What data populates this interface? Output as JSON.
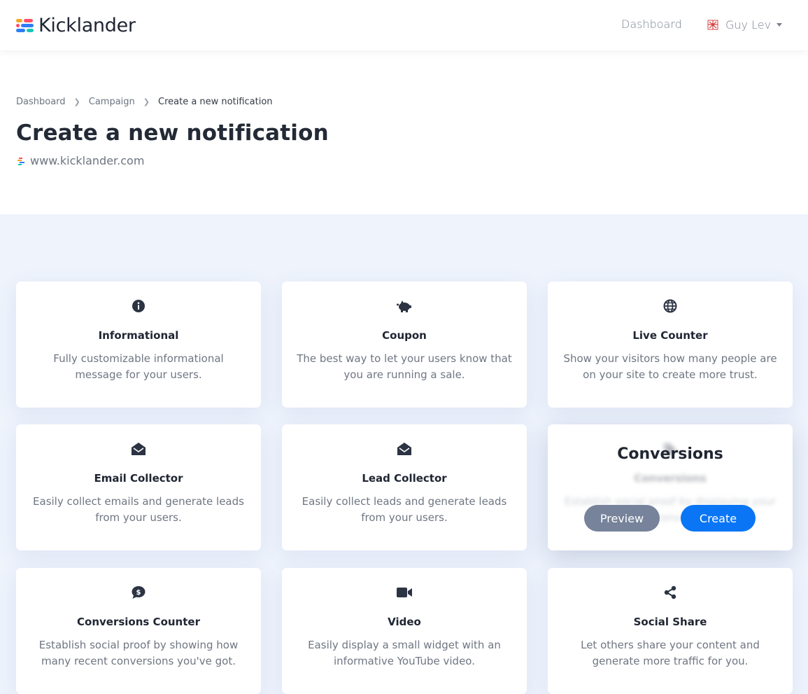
{
  "navbar": {
    "brand": "Kicklander",
    "dashboard_link": "Dashboard",
    "user_name": "Guy Lev"
  },
  "breadcrumb": [
    "Dashboard",
    "Campaign",
    "Create a new notification"
  ],
  "page": {
    "title": "Create a new notification",
    "site_url": "www.kicklander.com"
  },
  "cards": [
    {
      "title": "Informational",
      "desc": "Fully customizable informational message for your users.",
      "icon": "info-circle-icon"
    },
    {
      "title": "Coupon",
      "desc": "The best way to let your users know that you are running a sale.",
      "icon": "piggy-bank-icon"
    },
    {
      "title": "Live Counter",
      "desc": "Show your visitors how many people are on your site to create more trust.",
      "icon": "globe-icon"
    },
    {
      "title": "Email Collector",
      "desc": "Easily collect emails and generate leads from your users.",
      "icon": "envelope-open-icon"
    },
    {
      "title": "Lead Collector",
      "desc": "Easily collect leads and generate leads from your users.",
      "icon": "envelope-open-icon"
    },
    {
      "title": "Conversions",
      "desc": "Establish social proof by displaying your recent conversions.",
      "icon": "tag-icon"
    },
    {
      "title": "Conversions Counter",
      "desc": "Establish social proof by showing how many recent conversions you've got.",
      "icon": "comment-dollar-icon"
    },
    {
      "title": "Video",
      "desc": "Easily display a small widget with an informative YouTube video.",
      "icon": "video-icon"
    },
    {
      "title": "Social Share",
      "desc": "Let others share your content and generate more traffic for you.",
      "icon": "share-icon"
    }
  ],
  "hover_card": {
    "title": "Conversions",
    "preview_label": "Preview",
    "create_label": "Create"
  },
  "colors": {
    "primary": "#0a76f5",
    "preview_button": "#76839a",
    "page_background": "#eef3fc"
  }
}
